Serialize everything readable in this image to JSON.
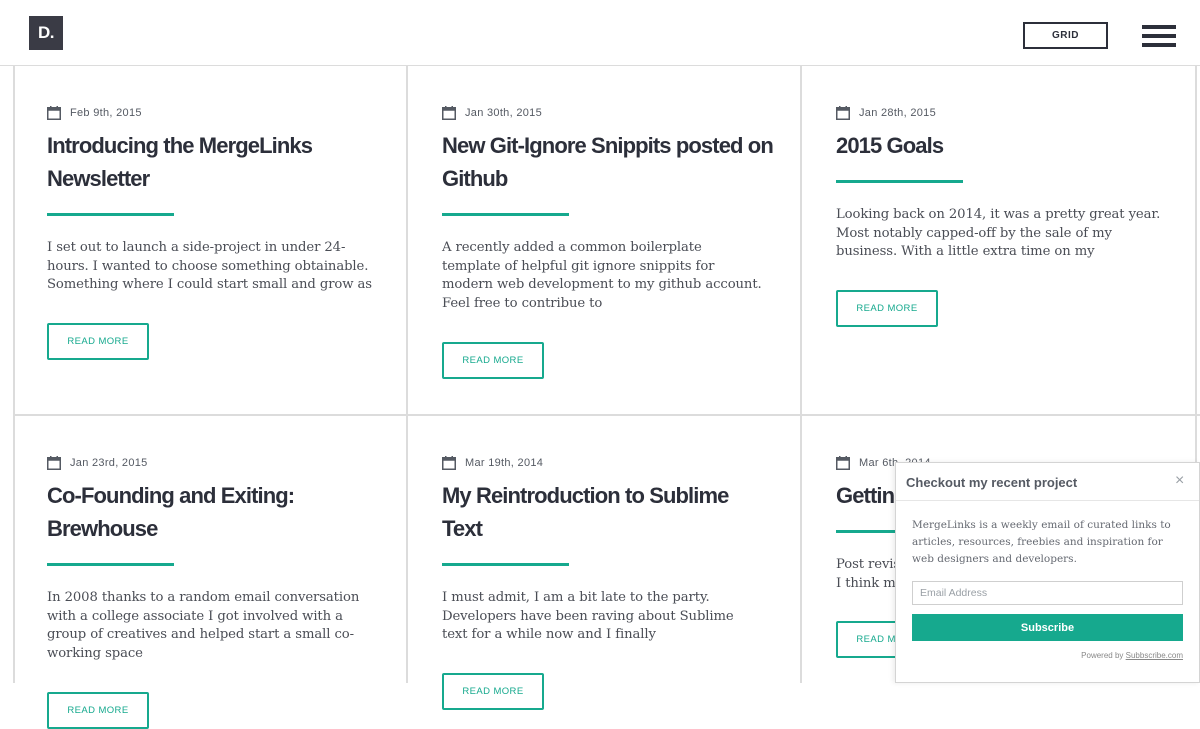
{
  "header": {
    "logo": "D.",
    "grid_label": "GRID"
  },
  "posts": [
    {
      "date": "Feb 9th, 2015",
      "title": "Introducing the MergeLinks Newsletter",
      "excerpt": "I set out to launch a side-project in under 24-hours. I wanted to choose something obtainable. Something where I could start small and grow as",
      "read_more": "READ MORE"
    },
    {
      "date": "Jan 30th, 2015",
      "title": "New Git-Ignore Snippits posted on Github",
      "excerpt": "A recently added a common boilerplate template of helpful git ignore snippits for modern web development to my github account. Feel free to contribue to",
      "read_more": "READ MORE"
    },
    {
      "date": "Jan 28th, 2015",
      "title": "2015 Goals",
      "excerpt": "Looking back on 2014, it was a pretty great year. Most notably capped-off by the sale of my business. With a little extra time on my",
      "read_more": "READ MORE"
    },
    {
      "date": "Jan 23rd, 2015",
      "title": "Co-Founding and Exiting: Brewhouse",
      "excerpt": "In 2008 thanks to a random email conversation with a college associate I got involved with a group of creatives and helped start a small co-working space",
      "read_more": "READ MORE"
    },
    {
      "date": "Mar 19th, 2014",
      "title": "My Reintroduction to Sublime Text",
      "excerpt": "I must admit, I am a bit late to the party. Developers have been raving about Sublime text for a while now and I finally",
      "read_more": "READ MORE"
    },
    {
      "date": "Mar 6th, 2014",
      "title": "Getting Started with WordPress",
      "excerpt": "Post revisions in WordPress can be a pain. Infact, I think most people turn them off for the first",
      "read_more": "READ MORE"
    }
  ],
  "popup": {
    "title": "Checkout my recent project",
    "close": "×",
    "description": "MergeLinks is a weekly email of curated links to articles, resources, freebies and inspiration for web designers and developers.",
    "email_placeholder": "Email Address",
    "subscribe_label": "Subscribe",
    "powered_prefix": "Powered by ",
    "powered_link": "Subbscribe.com"
  },
  "colors": {
    "accent": "#16a98e",
    "text_dark": "#2c2f3a",
    "logo_bg": "#3a3b45"
  }
}
